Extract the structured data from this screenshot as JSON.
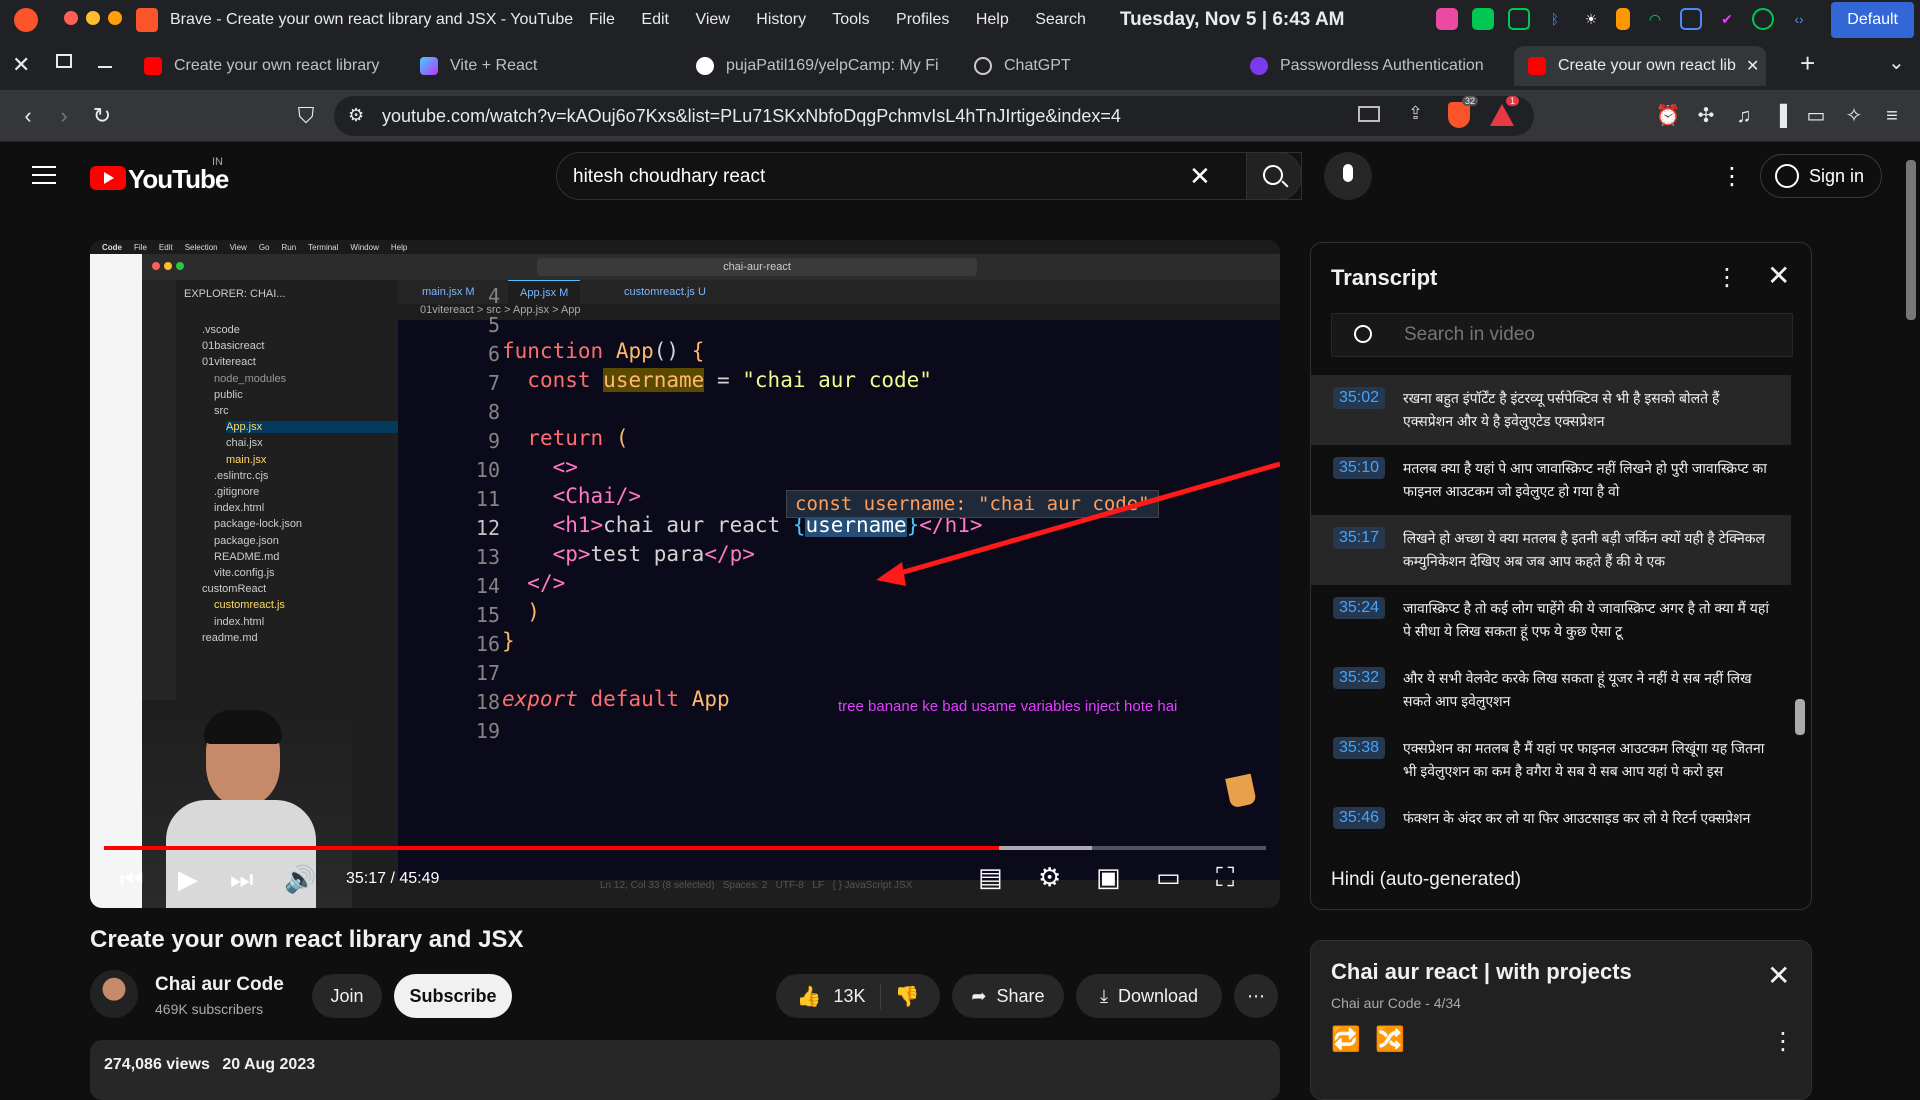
{
  "system": {
    "app_name": "Brave - Create your own react library and JSX - YouTube",
    "menu": [
      "File",
      "Edit",
      "View",
      "History",
      "Tools",
      "Profiles",
      "Help",
      "Search"
    ],
    "datetime": "Tuesday, Nov 5 | 6:43 AM",
    "profile": "Default"
  },
  "tabs": [
    {
      "label": "Create your own react library",
      "color": "#ff0000"
    },
    {
      "label": "Vite + React",
      "color": "#a855f7"
    },
    {
      "label": "pujaPatil169/yelpCamp: My Fi",
      "color": "#ffffff"
    },
    {
      "label": "ChatGPT",
      "color": "#cccccc"
    },
    {
      "label": "Passwordless Authentication",
      "color": "#7c3aed"
    },
    {
      "label": "Create your own react lib",
      "color": "#ff0000"
    }
  ],
  "address": {
    "url": "youtube.com/watch?v=kAOuj6o7Kxs&list=PLu71SKxNbfoDqgPchmvIsL4hTnJIrtige&index=4",
    "shield_count": "32",
    "alert_count": "1"
  },
  "youtube": {
    "logo_text": "YouTube",
    "region": "IN",
    "search_value": "hitesh choudhary react",
    "sign_in": "Sign in"
  },
  "video": {
    "time": "35:17 / 45:49",
    "progress": 0.77,
    "buffered": 0.85,
    "vscode": {
      "menu": [
        "Code",
        "File",
        "Edit",
        "Selection",
        "View",
        "Go",
        "Run",
        "Terminal",
        "Window",
        "Help"
      ],
      "search": "chai-aur-react",
      "explorer_title": "EXPLORER: CHAI...",
      "editor_tabs": [
        "main.jsx M",
        "App.jsx M",
        "customreact.js U"
      ],
      "breadcrumb": "01vitereact > src > App.jsx > App",
      "tree": [
        ".vscode",
        "01basicreact",
        "01vitereact",
        "node_modules",
        "public",
        "src",
        "App.jsx",
        "chai.jsx",
        "main.jsx",
        ".eslintrc.cjs",
        ".gitignore",
        "index.html",
        "package-lock.json",
        "package.json",
        "README.md",
        "vite.config.js",
        "customReact",
        "customreact.js",
        "index.html",
        "readme.md"
      ],
      "line_numbers": [
        "4",
        "5",
        "6",
        "7",
        "8",
        "9",
        "10",
        "11",
        "12",
        "13",
        "14",
        "15",
        "16",
        "17",
        "18",
        "19"
      ],
      "hover_tip": "const username: \"chai aur code\"",
      "annotation": "tree banane ke bad usame variables inject hote hai",
      "status": "Ln 12, Col 33 (8 selected)   Spaces: 2   UTF-8   LF   { } JavaScript JSX"
    }
  },
  "info": {
    "title": "Create your own react library and JSX",
    "channel": "Chai aur Code",
    "subscribers": "469K subscribers",
    "join": "Join",
    "subscribe": "Subscribe",
    "likes": "13K",
    "share": "Share",
    "download": "Download",
    "views": "274,086 views",
    "date": "20 Aug 2023"
  },
  "transcript": {
    "title": "Transcript",
    "search_placeholder": "Search in video",
    "language": "Hindi (auto-generated)",
    "segments": [
      {
        "time": "35:02",
        "text": "रखना बहुत इंपॉर्टेंट है इंटरव्यू पर्सपेक्टिव से भी है इसको बोलते हैं एक्सप्रेशन और ये है इवेलुएटेड एक्सप्रेशन"
      },
      {
        "time": "35:10",
        "text": "मतलब क्या है यहां पे आप जावास्क्रिप्ट नहीं लिखने हो पुरी जावास्क्रिप्ट का फाइनल आउटकम जो इवेलुएट हो गया है वो"
      },
      {
        "time": "35:17",
        "text": "लिखने हो अच्छा ये क्या मतलब है इतनी बड़ी जर्किन क्यों यही है टेक्निकल कम्युनिकेशन देखिए अब जब आप कहते हैं की ये एक"
      },
      {
        "time": "35:24",
        "text": "जावास्क्रिप्ट है तो कई लोग चाहेंगे की ये जावास्क्रिप्ट अगर है तो क्या मैं यहां पे सीधा ये लिख सकता हूं एफ ये कुछ ऐसा टू"
      },
      {
        "time": "35:32",
        "text": "और ये सभी वेलवेट करके लिख सकता हूं यूजर ने नहीं ये सब नहीं लिख सकते आप इवेलुएशन"
      },
      {
        "time": "35:38",
        "text": "एक्सप्रेशन का मतलब है मैं यहां पर फाइनल आउटकम लिखूंगा यह जितना भी इवेलुएशन का कम है वगैरा ये सब ये सब आप यहां पे करो इस"
      },
      {
        "time": "35:46",
        "text": "फंक्शन के अंदर कर लो या फिर आउटसाइड कर लो ये रिटर्न एक्सप्रेशन"
      }
    ]
  },
  "playlist": {
    "title": "Chai aur react | with projects",
    "subtitle": "Chai aur Code - 4/34"
  }
}
